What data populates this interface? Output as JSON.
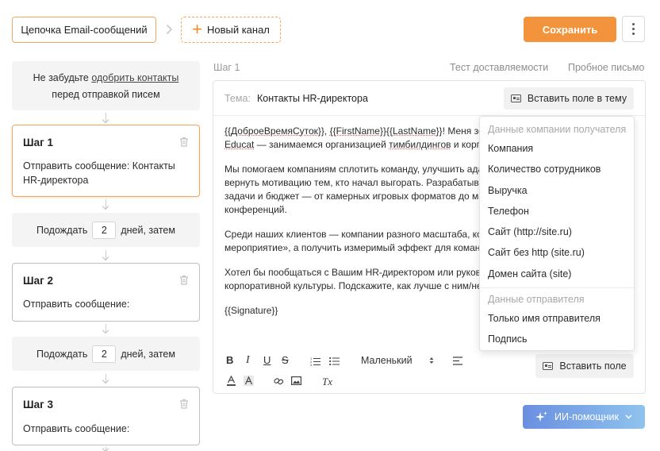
{
  "topbar": {
    "chain_label": "Цепочка Email-сообщений",
    "new_channel_label": "Новый канал",
    "save_label": "Сохранить"
  },
  "sidebar": {
    "reminder_prefix": "Не забудьте ",
    "reminder_link": "одобрить контакты",
    "reminder_suffix": "перед отправкой писем",
    "steps": [
      {
        "title": "Шаг 1",
        "desc": "Отправить сообщение: Контакты HR-директора"
      },
      {
        "title": "Шаг 2",
        "desc": "Отправить сообщение:"
      },
      {
        "title": "Шаг 3",
        "desc": "Отправить сообщение:"
      }
    ],
    "waits": [
      {
        "prefix": "Подождать",
        "days": "2",
        "suffix": "дней, затем"
      },
      {
        "prefix": "Подождать",
        "days": "2",
        "suffix": "дней, затем"
      }
    ]
  },
  "main": {
    "step_label": "Шаг 1",
    "test_delivery": "Тест доставляемости",
    "test_letter": "Пробное письмо",
    "subject_label": "Тема:",
    "subject_value": "Контакты HR-директора",
    "insert_topic_label": "Вставить поле в тему",
    "body": {
      "l1_a": "{{ДоброеВремяСуток}}",
      "l1_b": ", ",
      "l1_c": "{{FirstName}}{{LastName}}",
      "l1_d": "! Меня зов",
      "l2_a": "Educat",
      "l2_b": " — занимаемся организацией ",
      "l2_c": "тимбилдингов",
      "l2_d": " и корпо",
      "p2_l1": "Мы помогаем компаниям сплотить команду, улучшить адап",
      "p2_l2": "вернуть мотивацию тем, кто начал выгорать. Разрабатывае",
      "p2_l3": "задачи и бюджет — от камерных игровых форматов до мас",
      "p2_l4": "конференций.",
      "p3_l1": "Среди наших клиентов — компании разного масштаба, кот",
      "p3_l2": "мероприятие», а получить измеримый эффект для команд",
      "p4_l1": "Хотел бы пообщаться с Вашим HR-директором или руковод",
      "p4_l2": "корпоративной культуры. Подскажите, как лучше с ним/ней",
      "signature": "{{Signature}}"
    },
    "toolbar": {
      "bold": "B",
      "italic": "I",
      "underline": "U",
      "strike": "S",
      "size": "Маленький",
      "clear_format": "Tx",
      "insert_field_label": "Вставить поле"
    }
  },
  "dropdown": {
    "group1": "Данные компании получателя",
    "items1": [
      "Компания",
      "Количество сотрудников",
      "Выручка",
      "Телефон",
      "Сайт (http://site.ru)",
      "Сайт без http (site.ru)",
      "Домен сайта (site)"
    ],
    "group2": "Данные отправителя",
    "items2": [
      "Только имя отправителя",
      "Подпись"
    ]
  },
  "ai": {
    "label": "ИИ-помощник"
  },
  "colors": {
    "accent": "#f3933b",
    "accent_border": "#f0a765",
    "ai_from": "#6a8fe0",
    "ai_to": "#8fc3ee"
  }
}
